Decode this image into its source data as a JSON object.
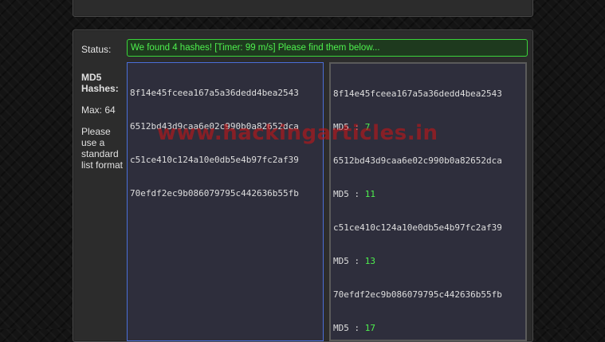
{
  "status": {
    "label": "Status:",
    "message": "We found 4 hashes! [Timer: 99 m/s] Please find them below..."
  },
  "sidebar": {
    "title": "MD5 Hashes:",
    "max": "Max: 64",
    "help": "Please use a standard list format"
  },
  "input_hashes": [
    "8f14e45fceea167a5a36dedd4bea2543",
    "6512bd43d9caa6e02c990b0a82652dca",
    "c51ce410c124a10e0db5e4b97fc2af39",
    "70efdf2ec9b086079795c442636b55fb"
  ],
  "results": [
    {
      "hash": "8f14e45fceea167a5a36dedd4bea2543",
      "prefix": "MD5 : ",
      "value": "7"
    },
    {
      "hash": "6512bd43d9caa6e02c990b0a82652dca",
      "prefix": "MD5 : ",
      "value": "11"
    },
    {
      "hash": "c51ce410c124a10e0db5e4b97fc2af39",
      "prefix": "MD5 : ",
      "value": "13"
    },
    {
      "hash": "70efdf2ec9b086079795c442636b55fb",
      "prefix": "MD5 : ",
      "value": "17"
    }
  ],
  "watermark": "www.hackingarticles.in",
  "colors": {
    "status_green": "#4ef04e",
    "input_border": "#4a6ed8",
    "watermark_red": "#d21414"
  }
}
